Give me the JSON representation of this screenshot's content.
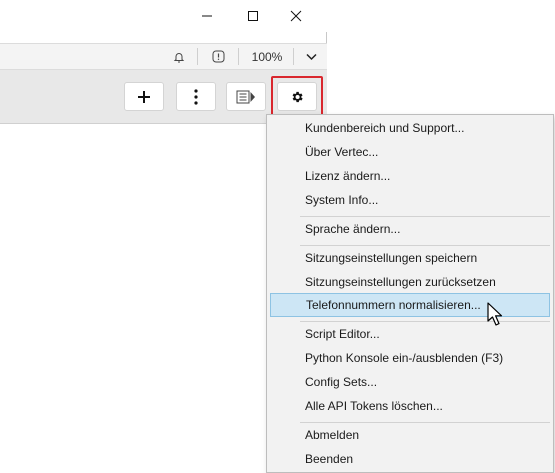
{
  "window_controls": {
    "minimize": "minimize",
    "maximize": "maximize",
    "close": "close"
  },
  "statusbar": {
    "zoom": "100%"
  },
  "toolbar": {
    "buttons": [
      "add-icon",
      "more-vert-icon",
      "panel-toggle-icon",
      "gear-icon"
    ]
  },
  "menu": {
    "items": [
      "Kundenbereich und Support...",
      "Über Vertec...",
      "Lizenz ändern...",
      "System Info...",
      "Sprache ändern...",
      "Sitzungseinstellungen speichern",
      "Sitzungseinstellungen zurücksetzen",
      "Telefonnummern normalisieren...",
      "Script Editor...",
      "Python Konsole ein-/ausblenden (F3)",
      "Config Sets...",
      "Alle API Tokens löschen...",
      "Abmelden",
      "Beenden"
    ],
    "hovered_index": 7
  },
  "colors": {
    "highlight_border": "#d9272e",
    "hover_bg": "#cde6f5",
    "hover_border": "#8ec3e3"
  }
}
